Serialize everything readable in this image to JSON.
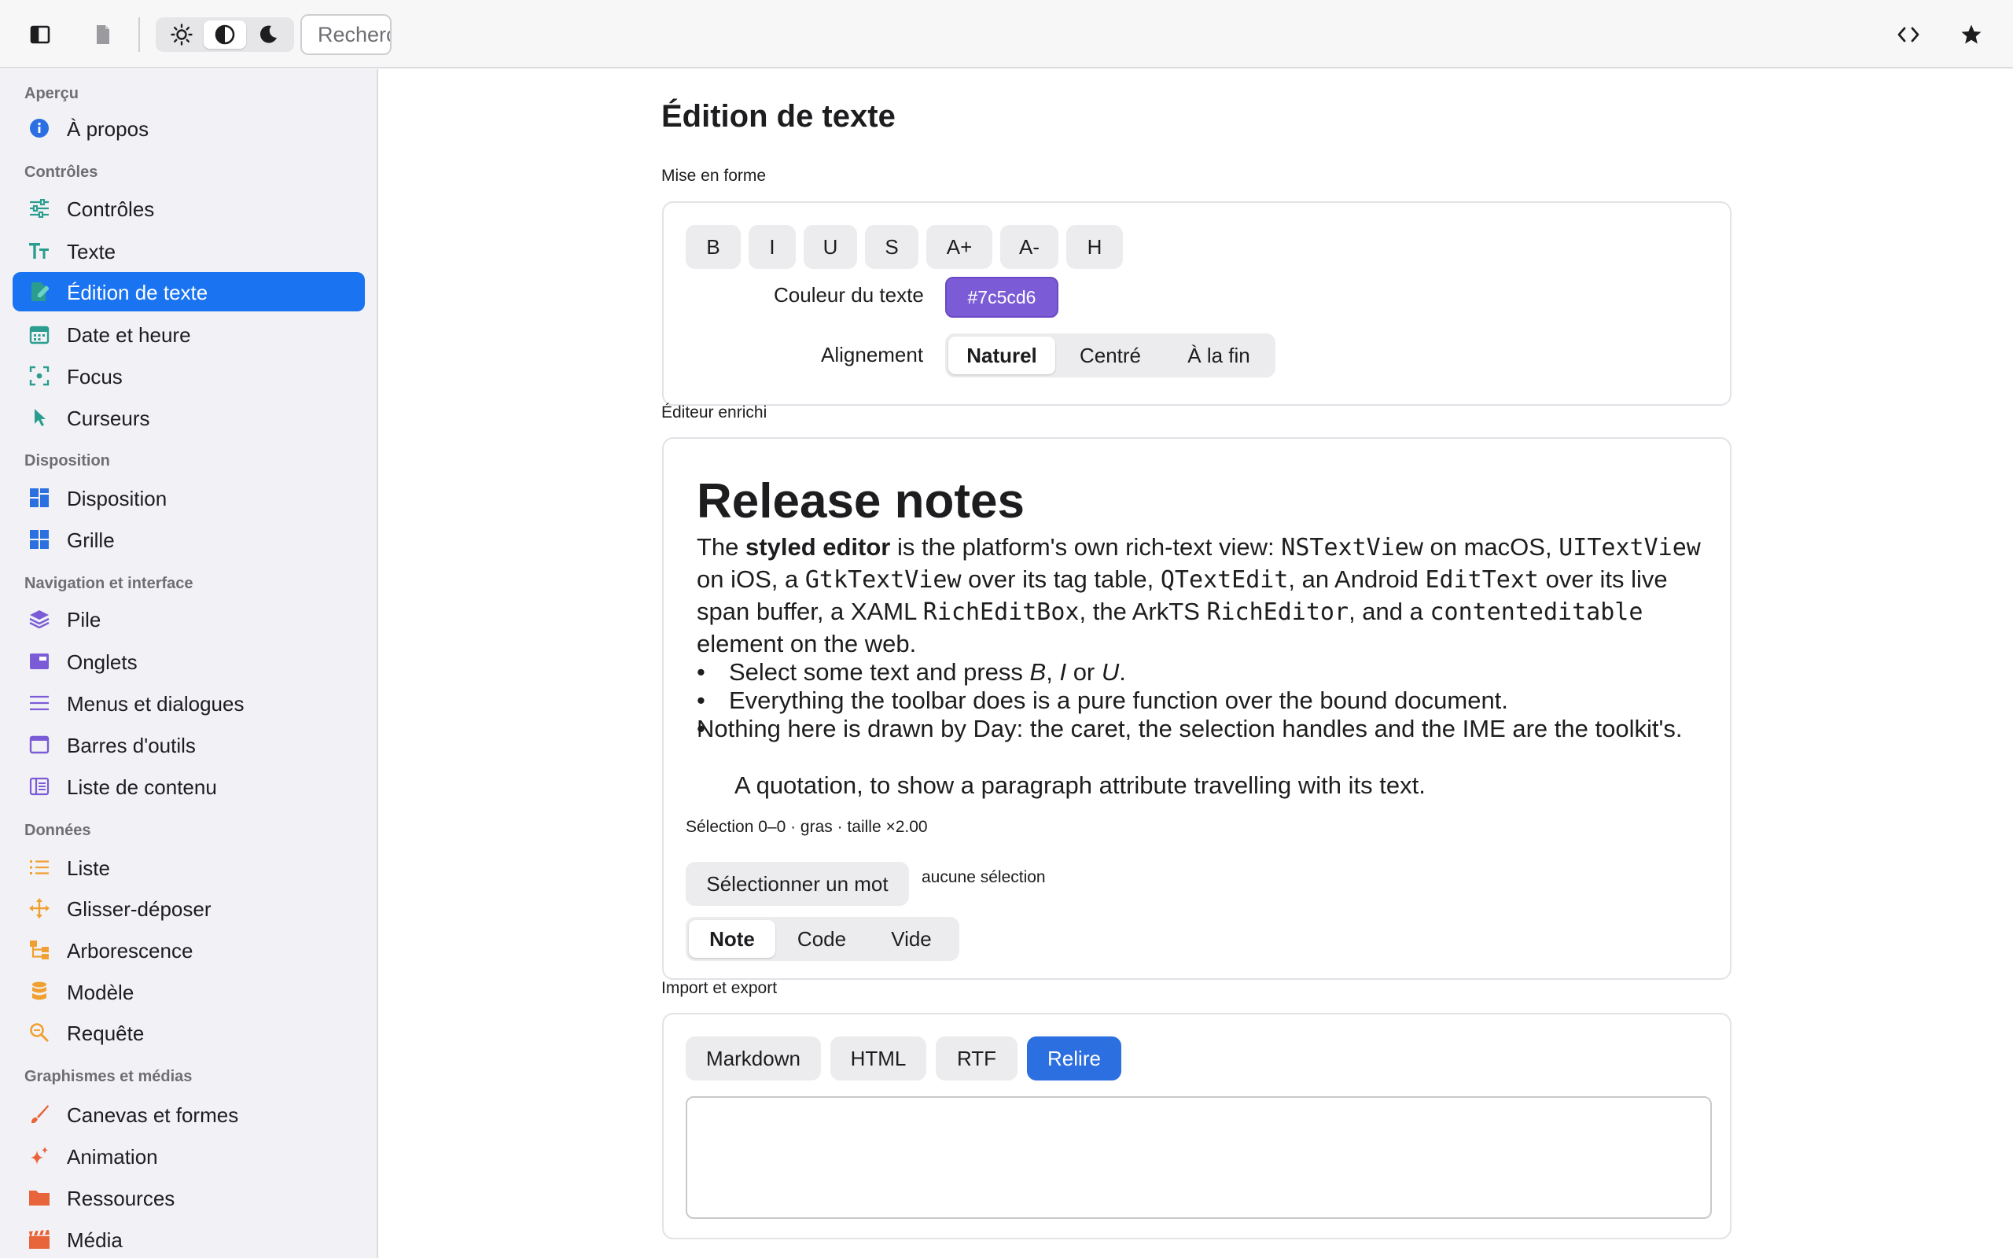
{
  "topbar": {
    "search_placeholder": "Recherc",
    "icons": [
      "sidebar-toggle-icon",
      "document-icon",
      "sun-icon",
      "contrast-icon",
      "moon-icon",
      "code-icon",
      "star-icon"
    ]
  },
  "sidebar": {
    "sections": [
      {
        "title": "Aperçu",
        "items": [
          {
            "label": "À propos",
            "icon": "info-icon"
          }
        ]
      },
      {
        "title": "Contrôles",
        "items": [
          {
            "label": "Contrôles",
            "icon": "sliders-icon"
          },
          {
            "label": "Texte",
            "icon": "text-size-icon"
          },
          {
            "label": "Édition de texte",
            "icon": "edit-document-icon",
            "active": true
          },
          {
            "label": "Date et heure",
            "icon": "calendar-icon"
          },
          {
            "label": "Focus",
            "icon": "focus-icon"
          },
          {
            "label": "Curseurs",
            "icon": "cursor-icon"
          }
        ]
      },
      {
        "title": "Disposition",
        "items": [
          {
            "label": "Disposition",
            "icon": "layout-icon"
          },
          {
            "label": "Grille",
            "icon": "grid-icon"
          }
        ]
      },
      {
        "title": "Navigation et interface",
        "items": [
          {
            "label": "Pile",
            "icon": "stack-icon"
          },
          {
            "label": "Onglets",
            "icon": "tabs-icon"
          },
          {
            "label": "Menus et dialogues",
            "icon": "menu-icon"
          },
          {
            "label": "Barres d'outils",
            "icon": "toolbar-icon"
          },
          {
            "label": "Liste de contenu",
            "icon": "content-list-icon"
          }
        ]
      },
      {
        "title": "Données",
        "items": [
          {
            "label": "Liste",
            "icon": "list-icon"
          },
          {
            "label": "Glisser-déposer",
            "icon": "move-icon"
          },
          {
            "label": "Arborescence",
            "icon": "tree-icon"
          },
          {
            "label": "Modèle",
            "icon": "database-icon"
          },
          {
            "label": "Requête",
            "icon": "search-icon"
          }
        ]
      },
      {
        "title": "Graphismes et médias",
        "items": [
          {
            "label": "Canevas et formes",
            "icon": "brush-icon"
          },
          {
            "label": "Animation",
            "icon": "sparkle-icon"
          },
          {
            "label": "Ressources",
            "icon": "folder-icon"
          },
          {
            "label": "Média",
            "icon": "clapper-icon"
          }
        ]
      }
    ]
  },
  "main": {
    "title": "Édition de texte",
    "formatting": {
      "label": "Mise en forme",
      "buttons": [
        "B",
        "I",
        "U",
        "S",
        "A+",
        "A-",
        "H"
      ],
      "color_label": "Couleur du texte",
      "color_value": "#7c5cd6",
      "align_label": "Alignement",
      "align_options": [
        "Naturel",
        "Centré",
        "À la fin"
      ],
      "align_selected": "Naturel"
    },
    "editor": {
      "label": "Éditeur enrichi",
      "heading": "Release notes",
      "para": {
        "t1": "The ",
        "b1": "styled editor",
        "t2": " is the platform's own rich-text view: ",
        "c1": "NSTextView",
        "t3": " on macOS, ",
        "c2": "UITextView",
        "t4": " on iOS, a ",
        "c3": "GtkTextView",
        "t5": " over its tag table, ",
        "c4": "QTextEdit",
        "t6": ", an Android ",
        "c5": "EditText",
        "t7": " over its live span buffer, a XAML ",
        "c6": "RichEditBox",
        "t8": ", the ArkTS ",
        "c7": "RichEditor",
        "t9": ", and a ",
        "c8": "contenteditable",
        "t10": " element on the web."
      },
      "bullet1": {
        "t1": "Select some text and press ",
        "i1": "B",
        "t2": ", ",
        "i2": "I",
        "t3": " or ",
        "i3": "U",
        "t4": "."
      },
      "bullet2": "Everything the toolbar does is a pure function over the bound document.",
      "bullet3": "Nothing here is drawn by Day: the caret, the selection handles and the IME are the toolkit's.",
      "quote": "A quotation, to show a paragraph attribute travelling with its text.",
      "status": "Sélection 0–0 · gras · taille ×2.00",
      "select_word_button": "Sélectionner un mot",
      "selection_text": "aucune sélection",
      "presets": [
        "Note",
        "Code",
        "Vide"
      ],
      "preset_selected": "Note"
    },
    "export": {
      "label": "Import et export",
      "buttons": [
        "Markdown",
        "HTML",
        "RTF",
        "Relire"
      ],
      "output_value": ""
    }
  },
  "colors": {
    "accent": "#1a73f0",
    "primary_button": "#2b6fe0",
    "text_color_swatch": "#7c5cd6"
  }
}
